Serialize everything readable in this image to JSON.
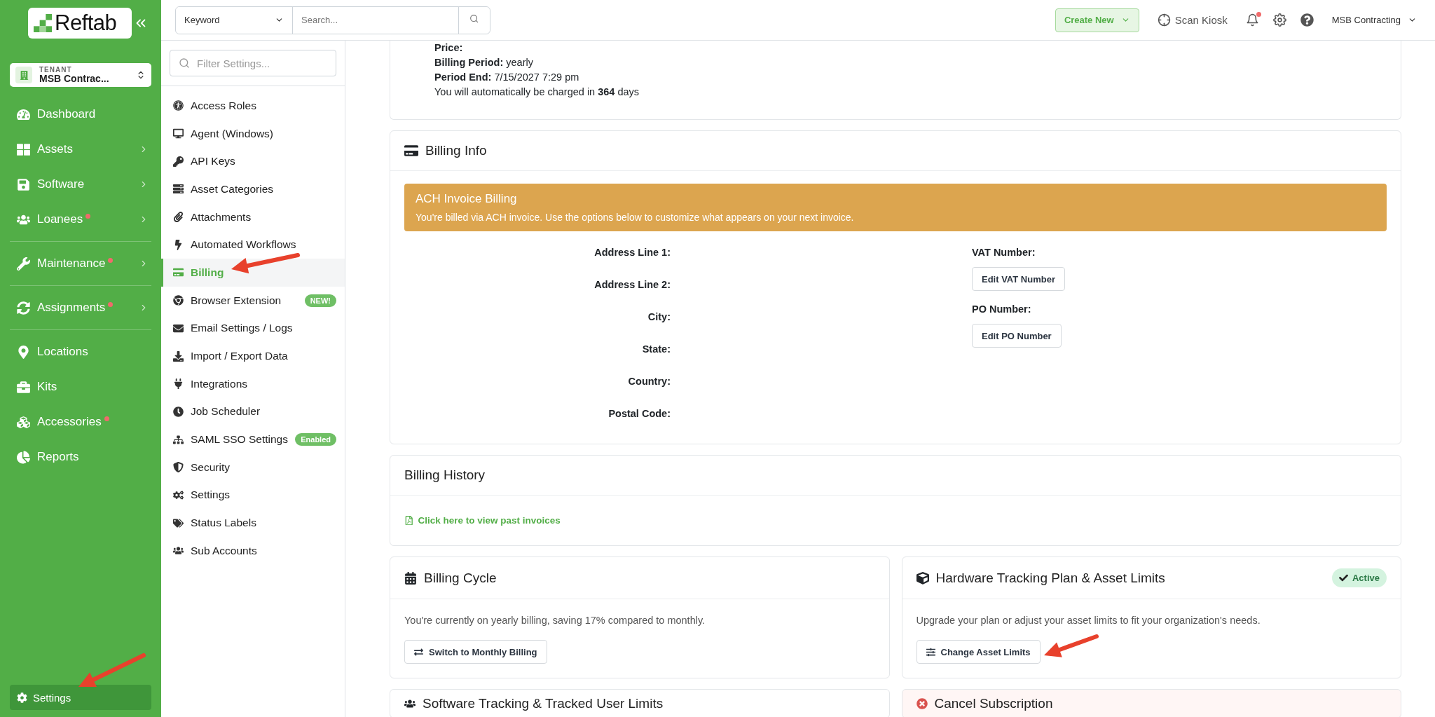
{
  "logo": {
    "text": "Reftab"
  },
  "tenant": {
    "label": "TENANT",
    "name": "MSB Contrac..."
  },
  "nav_sections": [
    {
      "items": [
        {
          "label": "Dashboard",
          "submenu": false,
          "alert_dot": false
        },
        {
          "label": "Assets",
          "submenu": true,
          "alert_dot": false
        },
        {
          "label": "Software",
          "submenu": true,
          "alert_dot": false
        },
        {
          "label": "Loanees",
          "submenu": true,
          "alert_dot": true
        }
      ]
    },
    {
      "items": [
        {
          "label": "Maintenance",
          "submenu": true,
          "alert_dot": true
        }
      ]
    },
    {
      "items": [
        {
          "label": "Assignments",
          "submenu": true,
          "alert_dot": true
        }
      ]
    },
    {
      "items": [
        {
          "label": "Locations",
          "submenu": false,
          "alert_dot": false
        },
        {
          "label": "Kits",
          "submenu": false,
          "alert_dot": false
        },
        {
          "label": "Accessories",
          "submenu": false,
          "alert_dot": true
        },
        {
          "label": "Reports",
          "submenu": false,
          "alert_dot": false
        }
      ]
    }
  ],
  "settings_link": {
    "label": "Settings",
    "selected": true
  },
  "search": {
    "scope": "Keyword",
    "placeholder": "Search..."
  },
  "topbar": {
    "create_button": "Create New",
    "scan_kiosk": "Scan Kiosk",
    "notification_dot": true,
    "account": "MSB Contracting"
  },
  "settings_menu": {
    "filter_placeholder": "Filter Settings...",
    "items": [
      {
        "label": "Access Roles",
        "selected": false
      },
      {
        "label": "Agent (Windows)",
        "selected": false
      },
      {
        "label": "API Keys",
        "selected": false
      },
      {
        "label": "Asset Categories",
        "selected": false
      },
      {
        "label": "Attachments",
        "selected": false
      },
      {
        "label": "Automated Workflows",
        "selected": false
      },
      {
        "label": "Billing",
        "selected": true
      },
      {
        "label": "Browser Extension",
        "selected": false,
        "badge": "NEW!"
      },
      {
        "label": "Email Settings / Logs",
        "selected": false
      },
      {
        "label": "Import / Export Data",
        "selected": false
      },
      {
        "label": "Integrations",
        "selected": false
      },
      {
        "label": "Job Scheduler",
        "selected": false
      },
      {
        "label": "SAML SSO Settings",
        "selected": false,
        "badge": "Enabled"
      },
      {
        "label": "Security",
        "selected": false
      },
      {
        "label": "Settings",
        "selected": false
      },
      {
        "label": "Status Labels",
        "selected": false
      },
      {
        "label": "Sub Accounts",
        "selected": false
      }
    ]
  },
  "subscription_summary": {
    "lines": [
      "**Price:**",
      "**Billing Period:** yearly",
      "**Period End:** 7/15/2027 7:29 pm",
      "You will automatically be charged in **364** days"
    ]
  },
  "billing_info": {
    "title": "Billing Info",
    "alert": {
      "title": "ACH Invoice Billing",
      "message": "You're billed via ACH invoice. Use the options below to customize what appears on your next invoice."
    },
    "address_fields": [
      "Address Line 1:",
      "Address Line 2:",
      "City:",
      "State:",
      "Country:",
      "Postal Code:"
    ],
    "extra_fields": [
      {
        "label": "VAT Number:",
        "button": "Edit VAT Number"
      },
      {
        "label": "PO Number:",
        "button": "Edit PO Number"
      }
    ]
  },
  "billing_history": {
    "title": "Billing History",
    "link": "Click here to view past invoices"
  },
  "billing_cycle": {
    "title": "Billing Cycle",
    "description": "You're currently on yearly billing, saving 17% compared to monthly.",
    "button": "Switch to Monthly Billing"
  },
  "hardware_plan": {
    "title": "Hardware Tracking Plan & Asset Limits",
    "status": "Active",
    "description": "Upgrade your plan or adjust your asset limits to fit your organization's needs.",
    "button": "Change Asset Limits"
  },
  "bottom_cards": [
    {
      "title": "Software Tracking & Tracked User Limits",
      "kind": "plan"
    },
    {
      "title": "Cancel Subscription",
      "kind": "danger"
    }
  ]
}
